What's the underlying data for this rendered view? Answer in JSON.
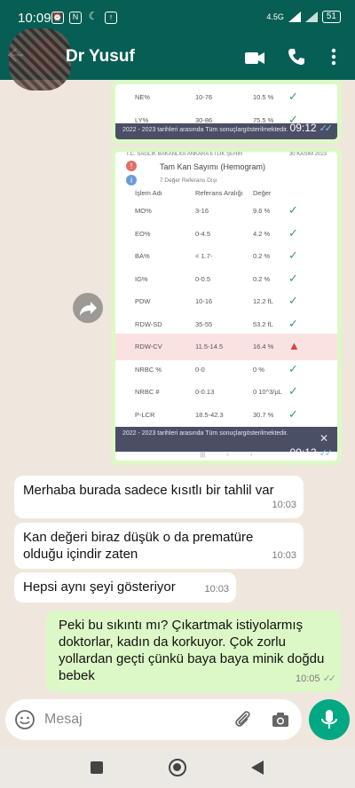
{
  "status": {
    "time": "10:09",
    "network": "4.5G",
    "battery": "51"
  },
  "header": {
    "name": "Dr Yusuf"
  },
  "image1": {
    "rows": [
      {
        "name": "NE%",
        "ref": "10-76",
        "val": "10.5 %"
      },
      {
        "name": "LY%",
        "ref": "30-86",
        "val": "75.5 %"
      }
    ],
    "banner": "2022 - 2023 tarihleri arasında Tüm sonuçlargösterilmektedir.",
    "time": "09:12"
  },
  "image2": {
    "top": "T.C. SAĞLIK BAKANLIĞI ANKARA ETLİK ŞEHİR",
    "date": "30 KASIM 2023",
    "title": "Tam Kan Sayımı (Hemogram)",
    "subtitle": "7 Değer Referans Dışı",
    "headers": {
      "name": "İşlem Adı",
      "ref": "Referans Aralığı",
      "val": "Değer"
    },
    "rows": [
      {
        "name": "MO%",
        "ref": "3-16",
        "val": "9.6 %"
      },
      {
        "name": "EO%",
        "ref": "0-4.5",
        "val": "4.2 %"
      },
      {
        "name": "BA%",
        "ref": "< 1.7-",
        "val": "0.2 %"
      },
      {
        "name": "IG%",
        "ref": "0-0.5",
        "val": "0.2 %"
      },
      {
        "name": "PDW",
        "ref": "10-16",
        "val": "12.2 fL"
      },
      {
        "name": "RDW-SD",
        "ref": "35-55",
        "val": "53.2 fL"
      },
      {
        "name": "RDW-CV",
        "ref": "11.5-14.5",
        "val": "16.4 %"
      },
      {
        "name": "NRBC %",
        "ref": "0-0",
        "val": "0 %"
      },
      {
        "name": "NRBC #",
        "ref": "0-0.13",
        "val": "0 10^3/µL"
      },
      {
        "name": "P-LCR",
        "ref": "18.5-42.3",
        "val": "30.7 %"
      }
    ],
    "banner": "2022 - 2023 tarihleri arasında Tüm sonuçlargösterilmektedir.",
    "time": "09:12"
  },
  "messages": [
    {
      "text": "Merhaba burada sadece kısıtlı bir tahlil var",
      "time": "10:03"
    },
    {
      "text": "Kan değeri biraz düşük o da prematüre olduğu içindir zaten",
      "time": "10:03"
    },
    {
      "text": "Hepsi aynı şeyi gösteriyor",
      "time": "10:03"
    },
    {
      "text": "Peki bu sıkıntı mı? Çıkartmak istiyolarmış doktorlar, kadın da korkuyor. Çok zorlu yollardan geçti çünkü baya baya minik doğdu bebek",
      "time": "10:05"
    }
  ],
  "input": {
    "placeholder": "Mesaj"
  },
  "colors": {
    "header": "#075e54",
    "outgoing": "#dcf8c6",
    "accent": "#00a884"
  }
}
